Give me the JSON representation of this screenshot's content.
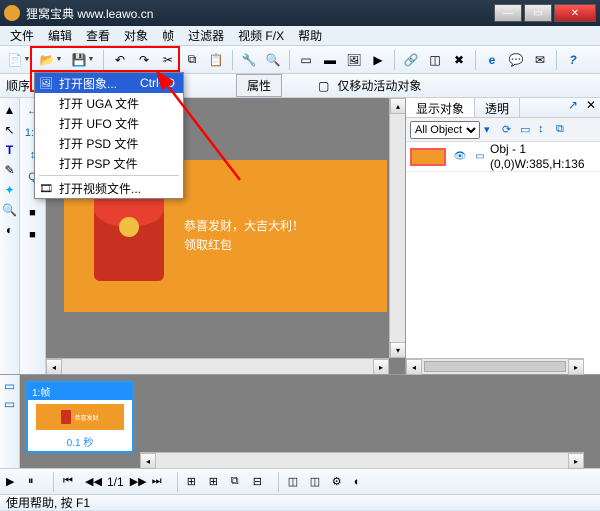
{
  "window": {
    "title": "狸窝宝典  www.leawo.cn"
  },
  "menu": {
    "items": [
      "文件",
      "编辑",
      "查看",
      "对象",
      "帧",
      "过滤器",
      "视频 F/X",
      "帮助"
    ]
  },
  "toolbar_icons": {
    "new": "📄",
    "open": "📂",
    "save": "💾",
    "undo": "↶",
    "redo": "↷",
    "cut": "✂",
    "copy": "⧉",
    "paste": "📋",
    "props": "🔧",
    "zoom": "🔍",
    "box": "▭",
    "boxfill": "▬",
    "img": "🖼",
    "play": "▶",
    "link": "🔗",
    "crop": "◫",
    "del": "✖",
    "ie": "e",
    "chat": "💬",
    "mail": "✉",
    "help": "?"
  },
  "optbar": {
    "label_order": "顺序",
    "btn_props": "属性",
    "check_moveonly": "仅移动活动对象"
  },
  "left_tools": {
    "a": "▲",
    "b": "↖",
    "c": "T",
    "d": "✎",
    "e": "✦",
    "f": "🔍",
    "g": "◐"
  },
  "left_tools2": {
    "a": "↔",
    "b": "1:1",
    "c": "↕",
    "d": "Q",
    "sw1": "■",
    "sw2": "■"
  },
  "canvas": {
    "line1": "恭喜发财，大吉大利！",
    "line2": "领取红包"
  },
  "dropdown": {
    "open_image": "打开图象...",
    "open_image_shortcut": "Ctrl+O",
    "open_uga": "打开 UGA 文件",
    "open_ufo": "打开 UFO 文件",
    "open_psd": "打开 PSD 文件",
    "open_psp": "打开 PSP 文件",
    "open_video": "打开视频文件..."
  },
  "right": {
    "tab_show": "显示对象",
    "tab_trans": "透明",
    "select_all": "All Object",
    "obj_name": "Obj - 1",
    "obj_bounds": "(0,0)W:385,H:136"
  },
  "timeline": {
    "frame_label": "1:帧",
    "duration": "0.1 秒",
    "position": "1/1",
    "mini_text": "恭喜发财"
  },
  "status": {
    "help": "使用帮助, 按 F1"
  }
}
